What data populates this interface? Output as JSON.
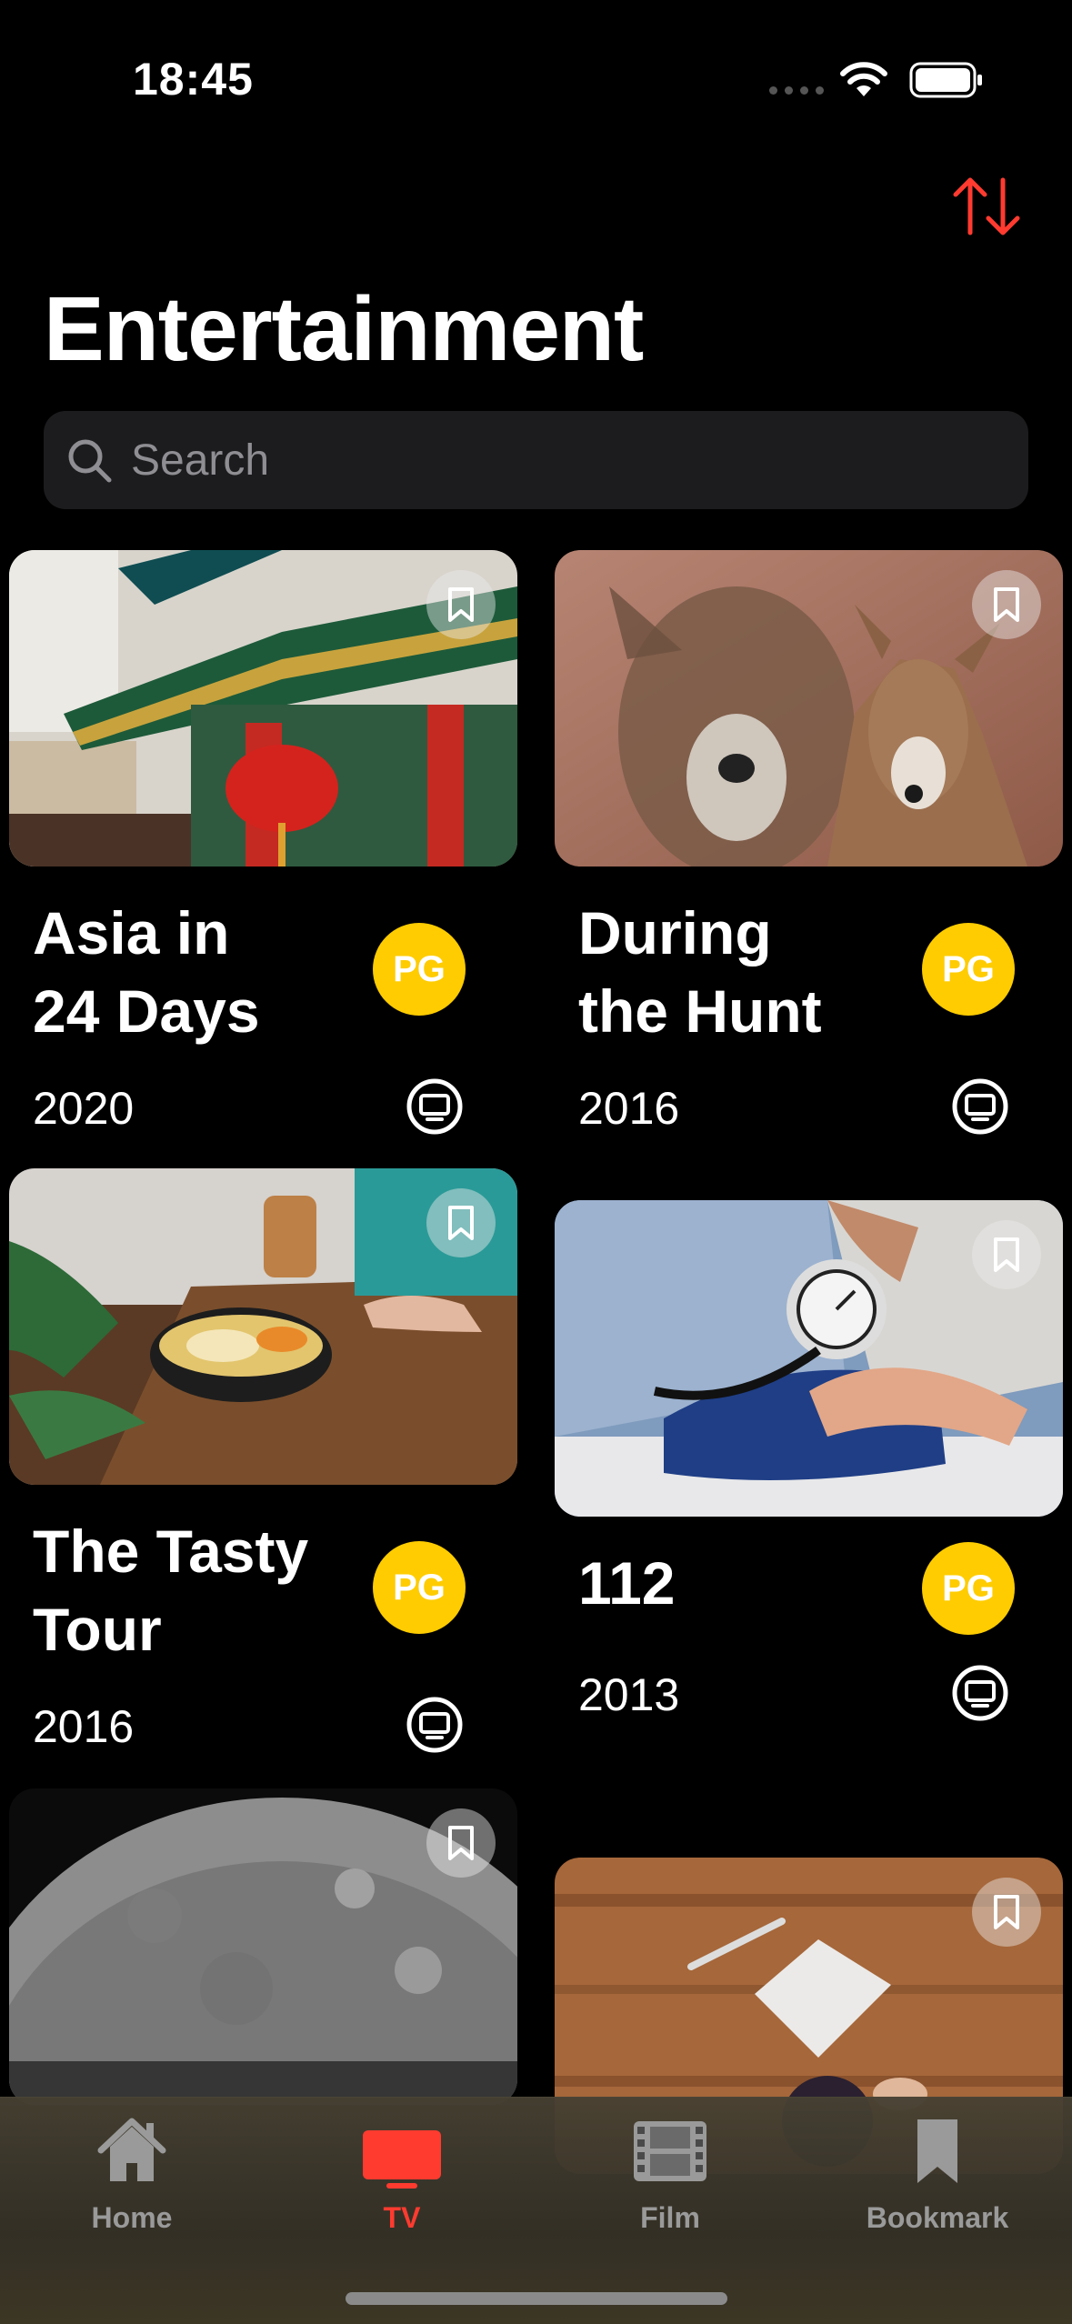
{
  "status": {
    "time": "18:45"
  },
  "header": {
    "title": "Entertainment"
  },
  "search": {
    "placeholder": "Search"
  },
  "colors": {
    "accent": "#ff3b30",
    "rating_badge": "#fecc00",
    "background": "#000000",
    "search_bg": "#1c1c1e"
  },
  "cards": [
    {
      "title_line1": "Asia in",
      "title_line2": "24 Days",
      "rating": "PG",
      "year": "2020",
      "type_icon": "tv-icon",
      "image": "chinese-temple-lantern"
    },
    {
      "title_line1": "During",
      "title_line2": "the Hunt",
      "rating": "PG",
      "year": "2016",
      "type_icon": "tv-icon",
      "image": "deer-in-field"
    },
    {
      "title_line1": "The Tasty",
      "title_line2": "Tour",
      "rating": "PG",
      "year": "2016",
      "type_icon": "tv-icon",
      "image": "smoothie-bowl-on-table"
    },
    {
      "title_line1": "112",
      "rating": "PG",
      "year": "2013",
      "type_icon": "tv-icon",
      "image": "blood-pressure-check"
    },
    {
      "image": "moon-surface"
    },
    {
      "image": "desk-with-notes-and-coffee"
    }
  ],
  "tabs": [
    {
      "label": "Home",
      "icon": "house-icon",
      "active": false
    },
    {
      "label": "TV",
      "icon": "tv-icon",
      "active": true
    },
    {
      "label": "Film",
      "icon": "film-icon",
      "active": false
    },
    {
      "label": "Bookmark",
      "icon": "bookmark-icon",
      "active": false
    }
  ]
}
